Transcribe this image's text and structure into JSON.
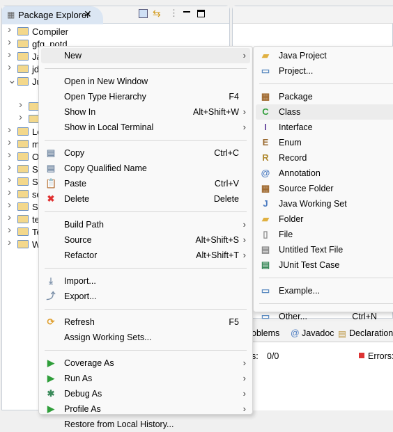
{
  "package_explorer": {
    "title": "Package Explorer",
    "tree": [
      {
        "label": "Compiler",
        "expanded": false
      },
      {
        "label": "gfg_potd",
        "expanded": false
      },
      {
        "label": "Ja",
        "expanded": false
      },
      {
        "label": "jd",
        "expanded": false
      },
      {
        "label": "Ju",
        "expanded": true
      },
      {
        "label": "",
        "expanded": null
      },
      {
        "label": "",
        "expanded": false
      },
      {
        "label": "",
        "expanded": false
      },
      {
        "label": "Lo",
        "expanded": false
      },
      {
        "label": "m",
        "expanded": false
      },
      {
        "label": "O",
        "expanded": false
      },
      {
        "label": "Sa",
        "expanded": false
      },
      {
        "label": "Se",
        "expanded": false
      },
      {
        "label": "se",
        "expanded": false
      },
      {
        "label": "St",
        "expanded": false
      },
      {
        "label": "te",
        "expanded": false
      },
      {
        "label": "Te",
        "expanded": false
      },
      {
        "label": "W",
        "expanded": false
      }
    ]
  },
  "context_menu": {
    "items": [
      {
        "label": "New",
        "shortcut": "",
        "submenu": true,
        "icon": ""
      },
      {
        "sep": true
      },
      {
        "label": "Open in New Window",
        "shortcut": "",
        "icon": ""
      },
      {
        "label": "Open Type Hierarchy",
        "shortcut": "F4",
        "icon": ""
      },
      {
        "label": "Show In",
        "shortcut": "Alt+Shift+W",
        "submenu": true,
        "icon": ""
      },
      {
        "label": "Show in Local Terminal",
        "shortcut": "",
        "submenu": true,
        "icon": ""
      },
      {
        "sep": true
      },
      {
        "label": "Copy",
        "shortcut": "Ctrl+C",
        "icon": "copy-icon"
      },
      {
        "label": "Copy Qualified Name",
        "shortcut": "",
        "icon": "copy-qualified-icon"
      },
      {
        "label": "Paste",
        "shortcut": "Ctrl+V",
        "icon": "paste-icon"
      },
      {
        "label": "Delete",
        "shortcut": "Delete",
        "icon": "delete-icon"
      },
      {
        "sep": true
      },
      {
        "label": "Build Path",
        "shortcut": "",
        "submenu": true,
        "icon": ""
      },
      {
        "label": "Source",
        "shortcut": "Alt+Shift+S",
        "submenu": true,
        "icon": ""
      },
      {
        "label": "Refactor",
        "shortcut": "Alt+Shift+T",
        "submenu": true,
        "icon": ""
      },
      {
        "sep": true
      },
      {
        "label": "Import...",
        "shortcut": "",
        "icon": "import-icon"
      },
      {
        "label": "Export...",
        "shortcut": "",
        "icon": "export-icon"
      },
      {
        "sep": true
      },
      {
        "label": "Refresh",
        "shortcut": "F5",
        "icon": "refresh-icon"
      },
      {
        "label": "Assign Working Sets...",
        "shortcut": "",
        "icon": ""
      },
      {
        "sep": true
      },
      {
        "label": "Coverage As",
        "shortcut": "",
        "submenu": true,
        "icon": "coverage-icon"
      },
      {
        "label": "Run As",
        "shortcut": "",
        "submenu": true,
        "icon": "run-icon"
      },
      {
        "label": "Debug As",
        "shortcut": "",
        "submenu": true,
        "icon": "debug-icon"
      },
      {
        "label": "Profile As",
        "shortcut": "",
        "submenu": true,
        "icon": "profile-icon"
      },
      {
        "label": "Restore from Local History...",
        "shortcut": "",
        "icon": ""
      }
    ]
  },
  "new_submenu": {
    "items": [
      {
        "label": "Java Project",
        "icon": "java-project-icon"
      },
      {
        "label": "Project...",
        "icon": "project-icon"
      },
      {
        "sep": true
      },
      {
        "label": "Package",
        "icon": "package-icon"
      },
      {
        "label": "Class",
        "icon": "class-icon",
        "highlighted": true
      },
      {
        "label": "Interface",
        "icon": "interface-icon"
      },
      {
        "label": "Enum",
        "icon": "enum-icon"
      },
      {
        "label": "Record",
        "icon": "record-icon"
      },
      {
        "label": "Annotation",
        "icon": "annotation-icon"
      },
      {
        "label": "Source Folder",
        "icon": "source-folder-icon"
      },
      {
        "label": "Java Working Set",
        "icon": "working-set-icon"
      },
      {
        "label": "Folder",
        "icon": "folder-icon"
      },
      {
        "label": "File",
        "icon": "file-icon"
      },
      {
        "label": "Untitled Text File",
        "icon": "text-file-icon"
      },
      {
        "label": "JUnit Test Case",
        "icon": "junit-icon"
      },
      {
        "sep": true
      },
      {
        "label": "Example...",
        "icon": "example-icon"
      },
      {
        "sep": true
      },
      {
        "label": "Other...",
        "shortcut": "Ctrl+N",
        "icon": "other-icon"
      }
    ]
  },
  "bottom_panel": {
    "tabs": [
      "oblems",
      "Javadoc",
      "Declaration"
    ],
    "status_left": "s:",
    "status_value": "0/0",
    "errors_label": "Errors:"
  },
  "colors": {
    "highlight": "#ececec",
    "tab_active": "#dbe6f3",
    "delete_red": "#e03030",
    "run_green": "#2f9e3a"
  }
}
